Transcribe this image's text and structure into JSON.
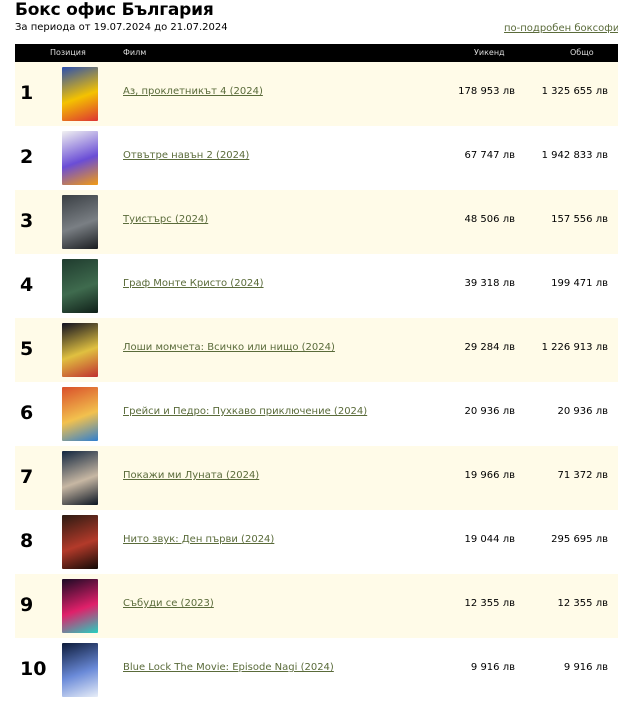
{
  "header": {
    "title": "Бокс офис България",
    "subtitle": "За периода от 19.07.2024 до 21.07.2024",
    "more_link": "по-подробен боксофис"
  },
  "table": {
    "columns": {
      "position": "Позиция",
      "film": "Филм",
      "weekend": "Уикенд",
      "total": "Общо"
    },
    "rows": [
      {
        "rank": "1",
        "title": "Аз, проклетникът 4 (2024)",
        "weekend": "178 953 лв",
        "total": "1 325 655 лв",
        "poster_colors": [
          "#2a4fb0",
          "#f4c200",
          "#d33"
        ]
      },
      {
        "rank": "2",
        "title": "Отвътре навън 2 (2024)",
        "weekend": "67 747 лв",
        "total": "1 942 833 лв",
        "poster_colors": [
          "#f1f1f1",
          "#6a4dd6",
          "#f39c12"
        ]
      },
      {
        "rank": "3",
        "title": "Туистърс (2024)",
        "weekend": "48 506 лв",
        "total": "157 556 лв",
        "poster_colors": [
          "#3a3f44",
          "#7a7f84",
          "#1a1d20"
        ]
      },
      {
        "rank": "4",
        "title": "Граф Монте Кристо (2024)",
        "weekend": "39 318 лв",
        "total": "199 471 лв",
        "poster_colors": [
          "#1f3b2e",
          "#3f6b4e",
          "#0f1f18"
        ]
      },
      {
        "rank": "5",
        "title": "Лоши момчета: Всичко или нищо (2024)",
        "weekend": "29 284 лв",
        "total": "1 226 913 лв",
        "poster_colors": [
          "#101020",
          "#e0c040",
          "#c03030"
        ]
      },
      {
        "rank": "6",
        "title": "Грейси и Педро: Пухкаво приключение (2024)",
        "weekend": "20 936 лв",
        "total": "20 936 лв",
        "poster_colors": [
          "#d94f2a",
          "#f2c14e",
          "#2f7fd0"
        ]
      },
      {
        "rank": "7",
        "title": "Покажи ми Луната (2024)",
        "weekend": "19 966 лв",
        "total": "71 372 лв",
        "poster_colors": [
          "#12263f",
          "#c7b7a3",
          "#0a1422"
        ]
      },
      {
        "rank": "8",
        "title": "Нито звук: Ден първи (2024)",
        "weekend": "19 044 лв",
        "total": "295 695 лв",
        "poster_colors": [
          "#2b1a12",
          "#b33a2a",
          "#120a06"
        ]
      },
      {
        "rank": "9",
        "title": "Събуди се (2023)",
        "weekend": "12 355 лв",
        "total": "12 355 лв",
        "poster_colors": [
          "#1a0a24",
          "#e0206a",
          "#24d0c0"
        ]
      },
      {
        "rank": "10",
        "title": "Blue Lock The Movie: Episode Nagi (2024)",
        "weekend": "9 916 лв",
        "total": "9 916 лв",
        "poster_colors": [
          "#0d1b3a",
          "#6a8ad8",
          "#e8eef8"
        ]
      }
    ]
  }
}
